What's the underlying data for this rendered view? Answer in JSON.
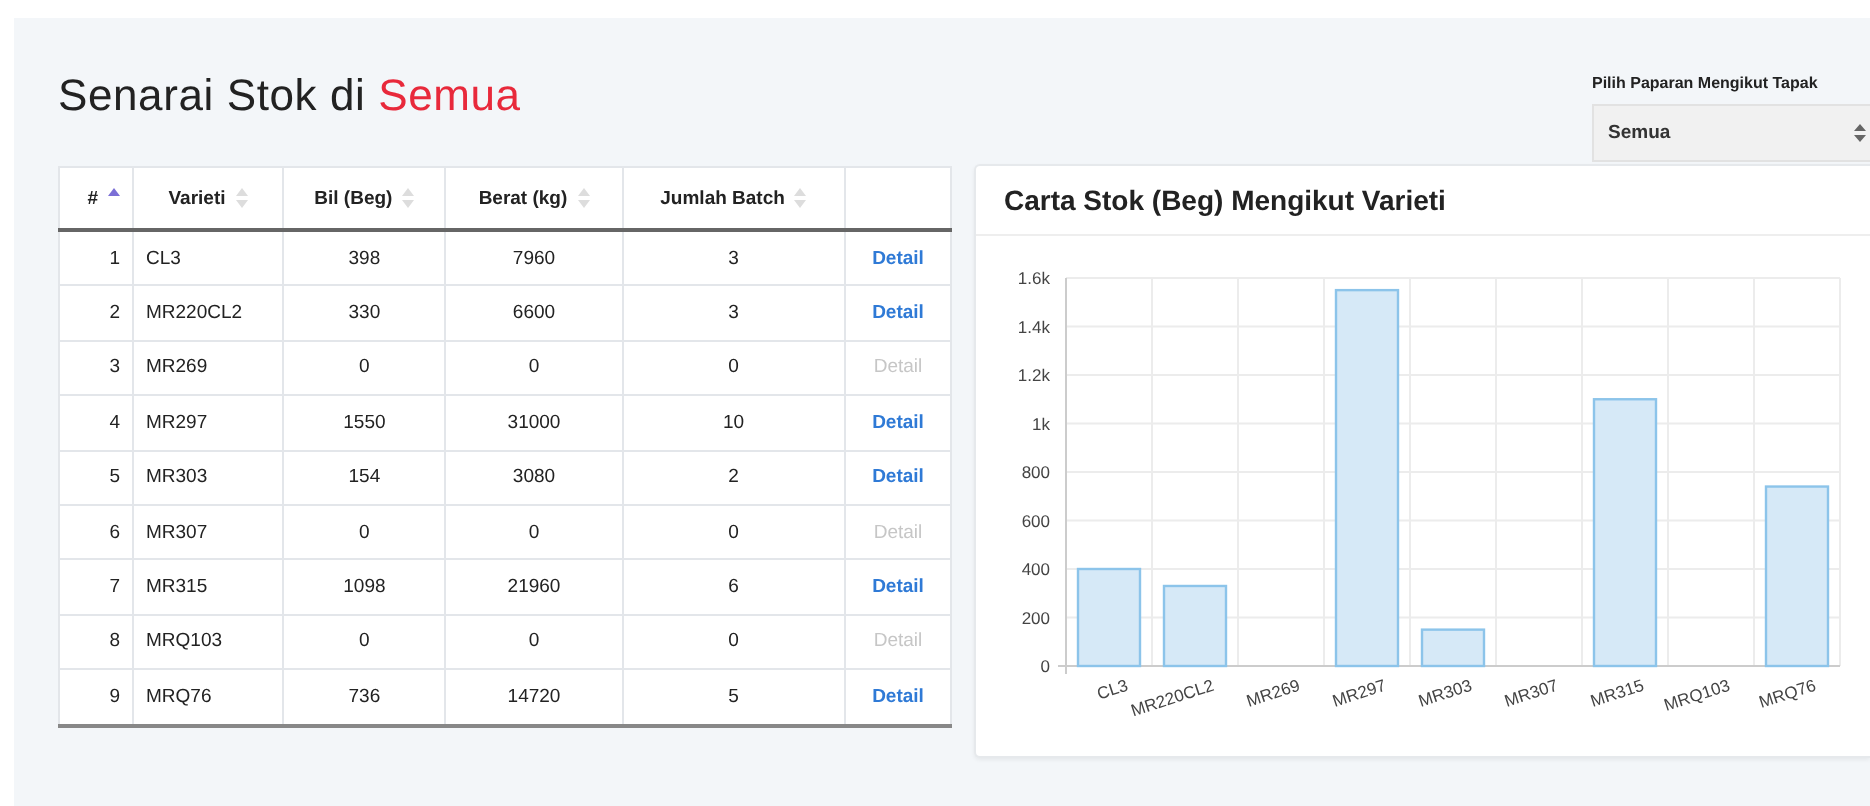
{
  "title": {
    "text": "Senarai Stok di",
    "highlight": "Semua"
  },
  "filter": {
    "label": "Pilih Paparan Mengikut Tapak",
    "value": "Semua"
  },
  "table": {
    "columns": [
      {
        "label": "#",
        "sorted": true
      },
      {
        "label": "Varieti",
        "sorted": false
      },
      {
        "label": "Bil (Beg)",
        "sorted": false
      },
      {
        "label": "Berat (kg)",
        "sorted": false
      },
      {
        "label": "Jumlah Batch",
        "sorted": false
      }
    ],
    "rows": [
      {
        "no": "1",
        "varieti": "CL3",
        "bil": "398",
        "berat": "7960",
        "batch": "3",
        "action": "Detail",
        "disabled": false
      },
      {
        "no": "2",
        "varieti": "MR220CL2",
        "bil": "330",
        "berat": "6600",
        "batch": "3",
        "action": "Detail",
        "disabled": false
      },
      {
        "no": "3",
        "varieti": "MR269",
        "bil": "0",
        "berat": "0",
        "batch": "0",
        "action": "Detail",
        "disabled": true
      },
      {
        "no": "4",
        "varieti": "MR297",
        "bil": "1550",
        "berat": "31000",
        "batch": "10",
        "action": "Detail",
        "disabled": false
      },
      {
        "no": "5",
        "varieti": "MR303",
        "bil": "154",
        "berat": "3080",
        "batch": "2",
        "action": "Detail",
        "disabled": false
      },
      {
        "no": "6",
        "varieti": "MR307",
        "bil": "0",
        "berat": "0",
        "batch": "0",
        "action": "Detail",
        "disabled": true
      },
      {
        "no": "7",
        "varieti": "MR315",
        "bil": "1098",
        "berat": "21960",
        "batch": "6",
        "action": "Detail",
        "disabled": false
      },
      {
        "no": "8",
        "varieti": "MRQ103",
        "bil": "0",
        "berat": "0",
        "batch": "0",
        "action": "Detail",
        "disabled": true
      },
      {
        "no": "9",
        "varieti": "MRQ76",
        "bil": "736",
        "berat": "14720",
        "batch": "5",
        "action": "Detail",
        "disabled": false
      }
    ]
  },
  "chart_card": {
    "title": "Carta Stok (Beg) Mengikut Varieti",
    "chart_data": {
      "type": "bar",
      "categories": [
        "CL3",
        "MR220CL2",
        "MR269",
        "MR297",
        "MR303",
        "MR307",
        "MR315",
        "MRQ103",
        "MRQ76"
      ],
      "series": [
        {
          "color": "#d6e9f7",
          "values": [
            400,
            330,
            0,
            1550,
            150,
            0,
            1100,
            0,
            740
          ]
        }
      ],
      "grid": true,
      "ylim": [
        0,
        1600
      ],
      "yticks": [
        0,
        200,
        400,
        600,
        800,
        {
          "value": 1000,
          "label": "1k"
        },
        {
          "value": 1200,
          "label": "1.2k"
        },
        {
          "value": 1400,
          "label": "1.4k"
        },
        {
          "value": 1600,
          "label": "1.6k"
        }
      ]
    }
  }
}
